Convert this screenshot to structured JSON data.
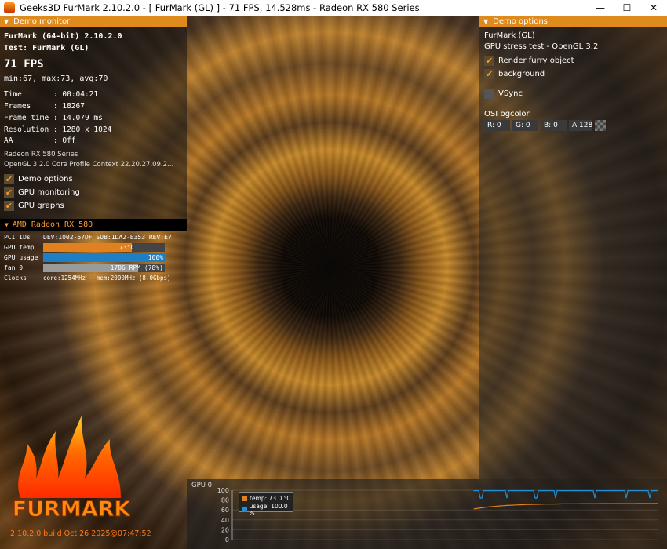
{
  "window": {
    "title": "Geeks3D FurMark 2.10.2.0 - [ FurMark (GL) ] - 71 FPS, 14.528ms - Radeon RX 580 Series",
    "minimize": "—",
    "maximize": "☐",
    "close": "✕"
  },
  "monitor": {
    "header": "Demo monitor",
    "app_line": "FurMark (64-bit) 2.10.2.0",
    "test_line": "Test: FurMark (GL)",
    "fps": "71 FPS",
    "fps_stats": "min:67, max:73, avg:70",
    "stats": [
      {
        "label": "Time       : ",
        "value": "00:04:21"
      },
      {
        "label": "Frames     : ",
        "value": "18267"
      },
      {
        "label": "Frame time : ",
        "value": "14.079 ms"
      },
      {
        "label": "Resolution : ",
        "value": "1280 x 1024"
      },
      {
        "label": "AA         : ",
        "value": "Off"
      }
    ],
    "gpu_name": "Radeon RX 580 Series",
    "gl_context": "OpenGL 3.2.0 Core Profile Context 22.20.27.09.2...",
    "options": [
      {
        "label": "Demo options",
        "checked": true
      },
      {
        "label": "GPU monitoring",
        "checked": true
      },
      {
        "label": "GPU graphs",
        "checked": true
      }
    ]
  },
  "gpu_panel": {
    "header": "AMD Radeon RX 580",
    "rows": [
      {
        "label": "PCI IDs",
        "value": "DEV:1002-67DF SUB:1DA2-E353 REV:E7"
      },
      {
        "label": "GPU temp",
        "value": "73°C",
        "fraction": 0.73,
        "color": "#e0801e"
      },
      {
        "label": "GPU usage",
        "value": "100%",
        "fraction": 1.0,
        "color": "#1f7fc4"
      },
      {
        "label": "fan 0",
        "value": "1786 RPM (78%)",
        "fraction": 0.78,
        "color": "#9a9a9a"
      },
      {
        "label": "Clocks",
        "value": "core:1254MHz - mem:2000MHz (8.0Gbps)"
      }
    ]
  },
  "options_panel": {
    "header": "Demo options",
    "demo_name": "FurMark (GL)",
    "demo_desc": "GPU stress test - OpenGL 3.2",
    "checks": [
      {
        "label": "Render furry object",
        "checked": true
      },
      {
        "label": "background",
        "checked": true
      }
    ],
    "vsync": {
      "label": "VSync",
      "checked": false
    },
    "osi_label": "OSI bgcolor",
    "osi": {
      "r": "R:  0",
      "g": "G:  0",
      "b": "B:  0",
      "a": "A:128"
    }
  },
  "graph": {
    "title": "GPU 0",
    "yticks": [
      "100",
      "80",
      "60",
      "40",
      "20",
      "0"
    ],
    "legend": [
      {
        "label": "temp: 73.0 °C",
        "color": "#e0801e"
      },
      {
        "label": "usage: 100.0 %",
        "color": "#1f8fd8"
      }
    ]
  },
  "logo_text": "FURMARK",
  "build": "2.10.2.0 build Oct 26 2025@07:47:52"
}
